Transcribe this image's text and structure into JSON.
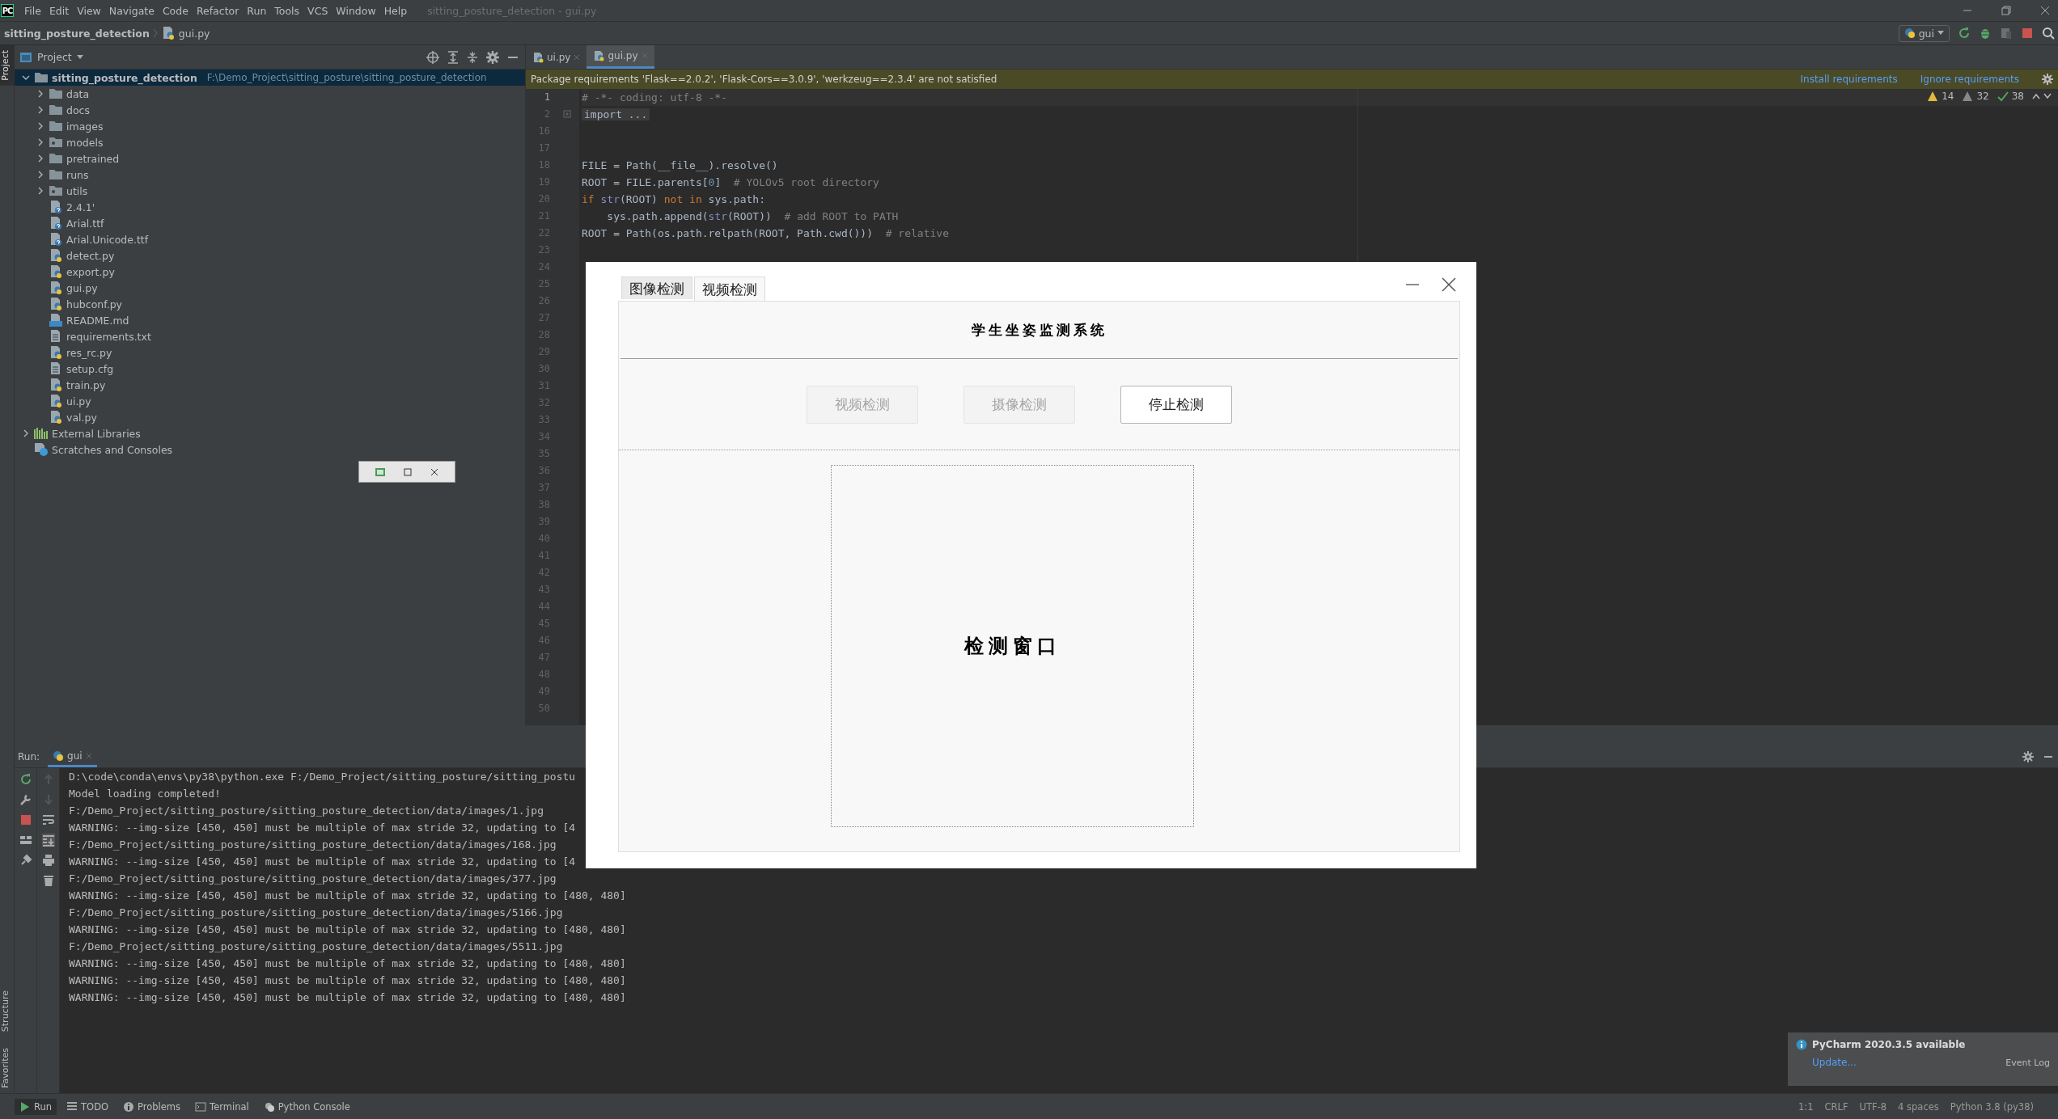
{
  "menu_bar": {
    "logo_text": "PC",
    "items": [
      "File",
      "Edit",
      "View",
      "Navigate",
      "Code",
      "Refactor",
      "Run",
      "Tools",
      "VCS",
      "Window",
      "Help"
    ],
    "window_title": "sitting_posture_detection - gui.py"
  },
  "nav_bar": {
    "breadcrumbs": [
      "sitting_posture_detection",
      "gui.py"
    ],
    "run_config": "gui"
  },
  "side_stripes": [
    {
      "label": "Project",
      "selected": true
    },
    {
      "label": "Structure",
      "selected": false
    },
    {
      "label": "Favorites",
      "selected": false
    }
  ],
  "project_panel": {
    "title": "Project",
    "tree": [
      {
        "label": "sitting_posture_detection",
        "path": "F:\\Demo_Project\\sitting_posture\\sitting_posture_detection",
        "kind": "folder",
        "expanded": true,
        "selected": true,
        "children": [
          {
            "label": "data",
            "kind": "folder",
            "expanded": false,
            "selected": false
          },
          {
            "label": "docs",
            "kind": "folder",
            "expanded": false,
            "selected": false
          },
          {
            "label": "images",
            "kind": "folder",
            "expanded": false,
            "selected": false
          },
          {
            "label": "models",
            "kind": "package",
            "expanded": false,
            "selected": false
          },
          {
            "label": "pretrained",
            "kind": "folder",
            "expanded": false,
            "selected": false
          },
          {
            "label": "runs",
            "kind": "folder",
            "expanded": false,
            "selected": false
          },
          {
            "label": "utils",
            "kind": "package",
            "expanded": false,
            "selected": false
          },
          {
            "label": "2.4.1'",
            "kind": "unknown",
            "selected": false
          },
          {
            "label": "Arial.ttf",
            "kind": "unknown",
            "selected": false
          },
          {
            "label": "Arial.Unicode.ttf",
            "kind": "unknown",
            "selected": false
          },
          {
            "label": "detect.py",
            "kind": "python",
            "selected": false
          },
          {
            "label": "export.py",
            "kind": "python",
            "selected": false
          },
          {
            "label": "gui.py",
            "kind": "python",
            "selected": false
          },
          {
            "label": "hubconf.py",
            "kind": "python",
            "selected": false
          },
          {
            "label": "README.md",
            "kind": "markdown",
            "selected": false
          },
          {
            "label": "requirements.txt",
            "kind": "text",
            "selected": false
          },
          {
            "label": "res_rc.py",
            "kind": "python",
            "selected": false
          },
          {
            "label": "setup.cfg",
            "kind": "text",
            "selected": false
          },
          {
            "label": "train.py",
            "kind": "python",
            "selected": false
          },
          {
            "label": "ui.py",
            "kind": "python",
            "selected": false
          },
          {
            "label": "val.py",
            "kind": "python",
            "selected": false
          }
        ]
      },
      {
        "label": "External Libraries",
        "kind": "library",
        "expanded": false,
        "selected": false
      },
      {
        "label": "Scratches and Consoles",
        "kind": "scratches",
        "selected": false
      }
    ]
  },
  "editor": {
    "tabs": [
      {
        "label": "ui.py",
        "selected": false
      },
      {
        "label": "gui.py",
        "selected": true
      }
    ],
    "banner": {
      "message": "Package requirements 'Flask==2.0.2', 'Flask-Cors==3.0.9', 'werkzeug==2.3.4' are not satisfied",
      "actions": [
        "Install requirements",
        "Ignore requirements"
      ]
    },
    "inspections": [
      {
        "kind": "warning",
        "count": "14"
      },
      {
        "kind": "weak",
        "count": "32"
      },
      {
        "kind": "typo",
        "count": "38"
      }
    ],
    "lines": [
      {
        "number": "1",
        "current": true,
        "segments": [
          {
            "text": "# -*- coding: utf-8 -*-",
            "kind": "comment"
          }
        ]
      },
      {
        "number": "2",
        "current": false,
        "segments": [
          {
            "text": "import ...",
            "kind": "folded"
          }
        ]
      },
      {
        "number": "16",
        "current": false
      },
      {
        "number": "17",
        "current": false
      },
      {
        "number": "18",
        "current": false,
        "segments": [
          {
            "text": "FILE = Path(__file__).resolve()",
            "kind": "plain"
          }
        ]
      },
      {
        "number": "19",
        "current": false,
        "segments": [
          {
            "text": "ROOT = FILE.parents[",
            "kind": "plain"
          },
          {
            "text": "0",
            "kind": "number"
          },
          {
            "text": "]  ",
            "kind": "plain"
          },
          {
            "text": "# YOLOv5 root directory",
            "kind": "comment"
          }
        ]
      },
      {
        "number": "20",
        "current": false,
        "segments": [
          {
            "text": "if ",
            "kind": "keyword"
          },
          {
            "text": "str",
            "kind": "builtin"
          },
          {
            "text": "(ROOT) ",
            "kind": "plain"
          },
          {
            "text": "not in ",
            "kind": "keyword"
          },
          {
            "text": "sys.path:",
            "kind": "plain"
          }
        ]
      },
      {
        "number": "21",
        "current": false,
        "segments": [
          {
            "text": "    sys.path.append(",
            "kind": "plain"
          },
          {
            "text": "str",
            "kind": "builtin"
          },
          {
            "text": "(ROOT))  ",
            "kind": "plain"
          },
          {
            "text": "# add ROOT to PATH",
            "kind": "comment"
          }
        ]
      },
      {
        "number": "22",
        "current": false,
        "segments": [
          {
            "text": "ROOT = Path(os.path.relpath(ROOT, Path.cwd()))  ",
            "kind": "plain"
          },
          {
            "text": "# relative",
            "kind": "comment"
          }
        ]
      },
      {
        "number": "23",
        "current": false
      },
      {
        "number": "24",
        "current": false
      },
      {
        "number": "25",
        "current": false
      },
      {
        "number": "26",
        "current": false
      },
      {
        "number": "27",
        "current": false
      },
      {
        "number": "28",
        "current": false
      },
      {
        "number": "29",
        "current": false
      },
      {
        "number": "30",
        "current": false
      },
      {
        "number": "31",
        "current": false
      },
      {
        "number": "32",
        "current": false
      },
      {
        "number": "33",
        "current": false
      },
      {
        "number": "34",
        "current": false
      },
      {
        "number": "35",
        "current": false
      },
      {
        "number": "36",
        "current": false
      },
      {
        "number": "37",
        "current": false
      },
      {
        "number": "38",
        "current": false
      },
      {
        "number": "39",
        "current": false
      },
      {
        "number": "40",
        "current": false
      },
      {
        "number": "41",
        "current": false
      },
      {
        "number": "42",
        "current": false
      },
      {
        "number": "43",
        "current": false
      },
      {
        "number": "44",
        "current": false
      },
      {
        "number": "45",
        "current": false
      },
      {
        "number": "46",
        "current": false
      },
      {
        "number": "47",
        "current": false
      },
      {
        "number": "48",
        "current": false
      },
      {
        "number": "49",
        "current": false
      },
      {
        "number": "50",
        "current": false
      }
    ]
  },
  "run_panel": {
    "label": "Run:",
    "tab": "gui",
    "output": [
      "D:\\code\\conda\\envs\\py38\\python.exe F:/Demo_Project/sitting_posture/sitting_postu",
      "Model loading completed!",
      "F:/Demo_Project/sitting_posture/sitting_posture_detection/data/images/1.jpg",
      "WARNING: --img-size [450, 450] must be multiple of max stride 32, updating to [4",
      "F:/Demo_Project/sitting_posture/sitting_posture_detection/data/images/168.jpg",
      "WARNING: --img-size [450, 450] must be multiple of max stride 32, updating to [4",
      "F:/Demo_Project/sitting_posture/sitting_posture_detection/data/images/377.jpg",
      "WARNING: --img-size [450, 450] must be multiple of max stride 32, updating to [480, 480]",
      "F:/Demo_Project/sitting_posture/sitting_posture_detection/data/images/5166.jpg",
      "WARNING: --img-size [450, 450] must be multiple of max stride 32, updating to [480, 480]",
      "F:/Demo_Project/sitting_posture/sitting_posture_detection/data/images/5511.jpg",
      "WARNING: --img-size [450, 450] must be multiple of max stride 32, updating to [480, 480]",
      "WARNING: --img-size [450, 450] must be multiple of max stride 32, updating to [480, 480]",
      "WARNING: --img-size [450, 450] must be multiple of max stride 32, updating to [480, 480]"
    ]
  },
  "tool_window_bar": [
    {
      "label": "Run",
      "kind": "run",
      "selected": true
    },
    {
      "label": "TODO",
      "kind": "todo",
      "selected": false
    },
    {
      "label": "Problems",
      "kind": "problems",
      "selected": false
    },
    {
      "label": "Terminal",
      "kind": "terminal",
      "selected": false
    },
    {
      "label": "Python Console",
      "kind": "python",
      "selected": false
    }
  ],
  "status_bar": [
    "1:1",
    "CRLF",
    "UTF-8",
    "4 spaces",
    "Python 3.8 (py38)"
  ],
  "notification": {
    "title": "PyCharm 2020.3.5 available",
    "link": "Update...",
    "event_log": "Event Log"
  },
  "dialog": {
    "tabs": [
      {
        "label": "图像检测",
        "selected": false
      },
      {
        "label": "视频检测",
        "selected": true
      }
    ],
    "title": "学生坐姿监测系统",
    "buttons": [
      {
        "label": "视频检测",
        "disabled": true
      },
      {
        "label": "摄像检测",
        "disabled": true
      },
      {
        "label": "停止检测",
        "disabled": false
      }
    ],
    "display": {
      "label": "检测窗口"
    }
  }
}
